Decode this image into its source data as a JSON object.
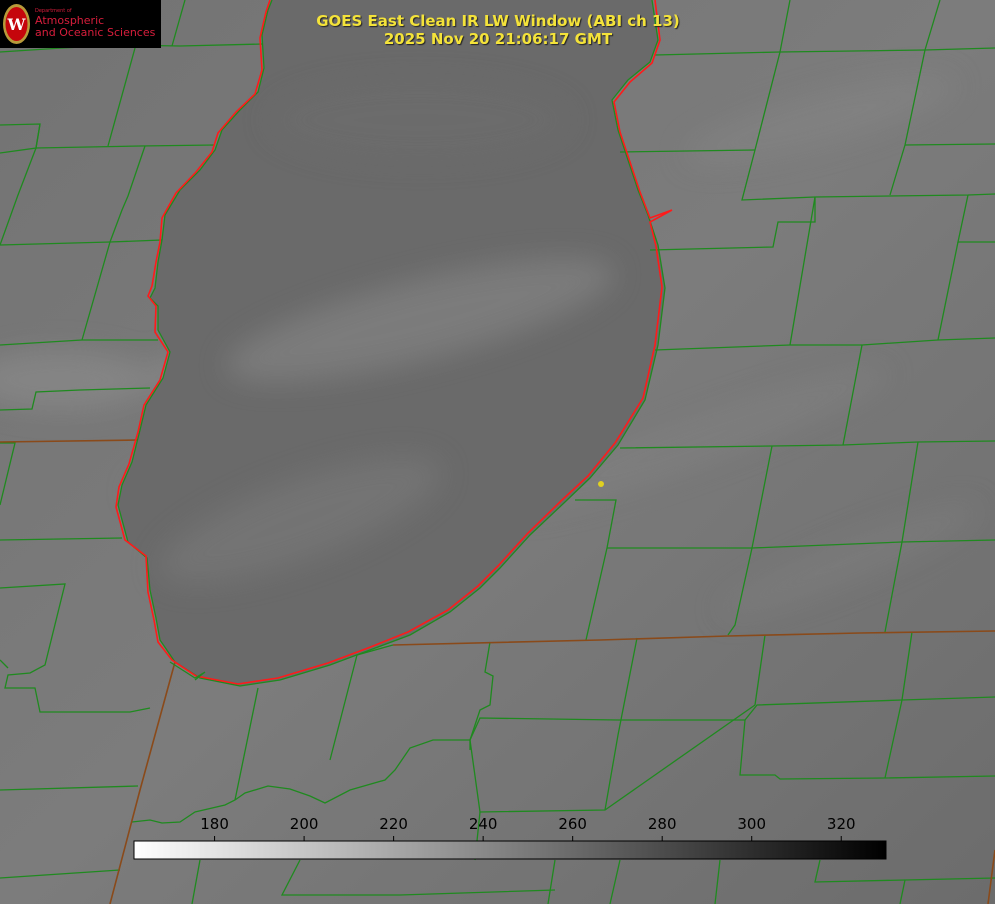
{
  "title": {
    "line1": "GOES East Clean IR LW Window (ABI ch 13)",
    "line2": "2025 Nov 20 21:06:17 GMT"
  },
  "logo": {
    "small_text": "Department of",
    "line1": "Atmospheric",
    "line2": "and Oceanic Sciences",
    "seal_letter": "W",
    "color": "#d81e3c"
  },
  "colorbar": {
    "min": 162,
    "max": 330,
    "ticks": [
      "180",
      "200",
      "220",
      "240",
      "260",
      "280",
      "300",
      "320"
    ],
    "gradient": [
      "#ffffff",
      "#000000"
    ]
  },
  "colors": {
    "county_lines": "#1f8a1f",
    "state_lines": "#8a4a1a",
    "lake_outline": "#ff1a1a",
    "marker": "#e0d020"
  },
  "icons": [
    "uw-seal-icon",
    "location-marker-icon"
  ]
}
